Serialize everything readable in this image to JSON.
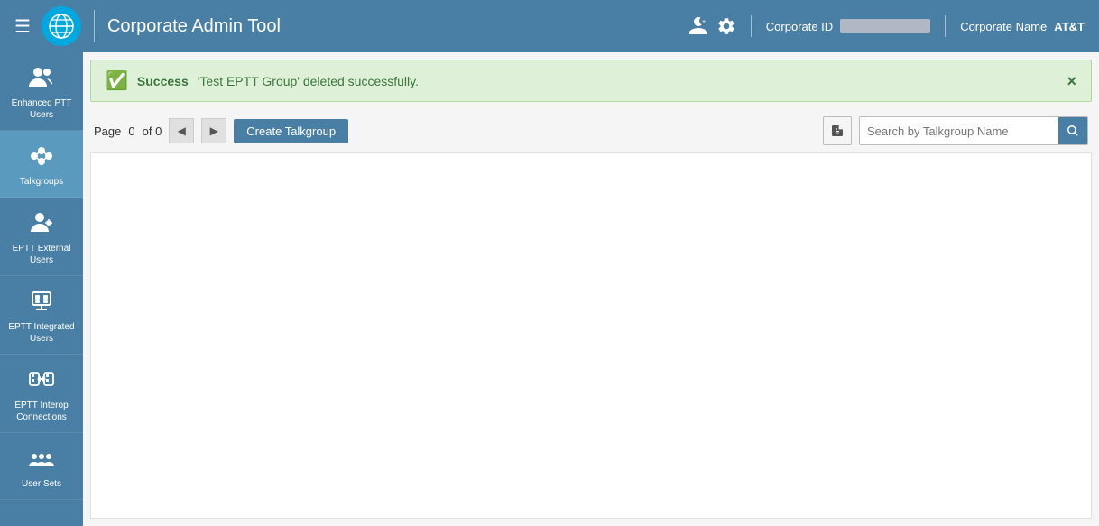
{
  "header": {
    "menu_icon": "☰",
    "title": "Corporate Admin Tool",
    "corp_id_label": "Corporate ID",
    "corp_name_label": "Corporate Name",
    "corp_name_value": "AT&T"
  },
  "success_banner": {
    "label": "Success",
    "message": "'Test EPTT Group' deleted successfully.",
    "close_label": "×"
  },
  "toolbar": {
    "page_label": "Page",
    "page_number": "0",
    "of_label": "of 0",
    "create_button_label": "Create Talkgroup",
    "search_placeholder": "Search by Talkgroup Name"
  },
  "sidebar": {
    "items": [
      {
        "id": "enhanced-ptt-users",
        "label": "Enhanced PTT Users",
        "active": false
      },
      {
        "id": "talkgroups",
        "label": "Talkgroups",
        "active": true
      },
      {
        "id": "eptt-external-users",
        "label": "EPTT External Users",
        "active": false
      },
      {
        "id": "eptt-integrated-users",
        "label": "EPTT Integrated Users",
        "active": false
      },
      {
        "id": "eptt-interop-connections",
        "label": "EPTT Interop Connections",
        "active": false
      },
      {
        "id": "user-sets",
        "label": "User Sets",
        "active": false
      }
    ]
  }
}
